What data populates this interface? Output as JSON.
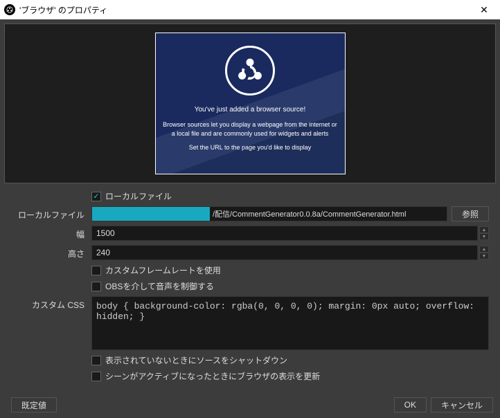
{
  "title": "'ブラウザ' のプロパティ",
  "preview": {
    "line1": "You've just added a browser source!",
    "line2": "Browser sources let you display a webpage from the internet or a local file and are commonly used for widgets and alerts",
    "line3": "Set the URL to the page you'd like to display"
  },
  "form": {
    "local_file_check": "ローカルファイル",
    "local_file_label": "ローカルファイル",
    "local_file_value": "/配信/CommentGenerator0.0.8a/CommentGenerator.html",
    "browse": "参照",
    "width_label": "幅",
    "width_value": "1500",
    "height_label": "高さ",
    "height_value": "240",
    "custom_fps": "カスタムフレームレートを使用",
    "obs_audio": "OBSを介して音声を制御する",
    "custom_css_label": "カスタム CSS",
    "custom_css_value": "body { background-color: rgba(0, 0, 0, 0); margin: 0px auto; overflow: hidden; }",
    "shutdown": "表示されていないときにソースをシャットダウン",
    "refresh": "シーンがアクティブになったときにブラウザの表示を更新"
  },
  "footer": {
    "defaults": "既定値",
    "ok": "OK",
    "cancel": "キャンセル"
  }
}
